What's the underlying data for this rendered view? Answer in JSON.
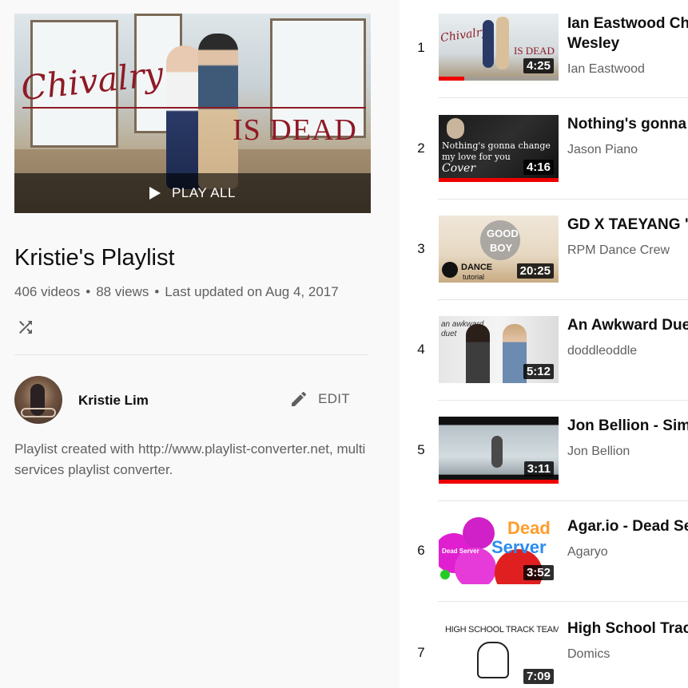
{
  "playlist": {
    "title": "Kristie's Playlist",
    "video_count": "406 videos",
    "views": "88 views",
    "updated": "Last updated on Aug 4, 2017",
    "play_all_label": "PLAY ALL",
    "hero_script_text": "Chivalry",
    "hero_title_text": "IS DEAD",
    "description": "Playlist created with http://www.playlist-converter.net, multi services playlist converter."
  },
  "owner": {
    "name": "Kristie Lim",
    "edit_label": "EDIT"
  },
  "icons": {
    "shuffle": "shuffle-icon",
    "edit": "pencil-icon",
    "play": "play-icon"
  },
  "videos": [
    {
      "index": "1",
      "title": "Ian Eastwood Choreography | Chivalry Is Dead by Trevor Wesley",
      "title_display": "Ian Eastwood Che Wesley",
      "channel": "Ian Eastwood",
      "duration": "4:25",
      "watched_fraction": 0.21,
      "thumb_text": "IS DEAD"
    },
    {
      "index": "2",
      "title": "Nothing's gonna change my love for you",
      "title_display": "Nothing's gonna c",
      "channel": "Jason Piano",
      "duration": "4:16",
      "watched_fraction": 1.0,
      "thumb_text_1": "Nothing's gonna change",
      "thumb_text_2": "my love for you",
      "thumb_text_3": "Cover"
    },
    {
      "index": "3",
      "title": "GD X TAEYANG \"G",
      "title_display": "GD X TAEYANG \"G",
      "channel": "RPM Dance Crew",
      "duration": "20:25",
      "thumb_text_1": "GOOD",
      "thumb_text_2": "BOY",
      "thumb_text_3": "DANCE",
      "thumb_text_4": "tutorial"
    },
    {
      "index": "4",
      "title": "An Awkward Duet",
      "title_display": "An Awkward Duet",
      "channel": "doddleoddle",
      "duration": "5:12",
      "thumb_text_1": "an awkward",
      "thumb_text_2": "duet"
    },
    {
      "index": "5",
      "title": "Jon Bellion - Sim",
      "title_display": "Jon Bellion - Sim",
      "channel": "Jon Bellion",
      "duration": "3:11",
      "watched_fraction": 1.0
    },
    {
      "index": "6",
      "title": "Agar.io - Dead Se",
      "title_display": "Agar.io - Dead Se",
      "channel": "Agaryo",
      "duration": "3:52",
      "thumb_text_1": "Dead",
      "thumb_text_2": "Server",
      "thumb_text_3": "Dead Server"
    },
    {
      "index": "7",
      "title": "High School Trac",
      "title_display": "High School Trac",
      "channel": "Domics",
      "duration": "7:09",
      "thumb_text_1": "HIGH SCHOOL TRACK TEAM"
    }
  ],
  "colors": {
    "progress": "#ee0000",
    "left_bg": "#f9f9f9",
    "secondary_text": "#606060"
  }
}
